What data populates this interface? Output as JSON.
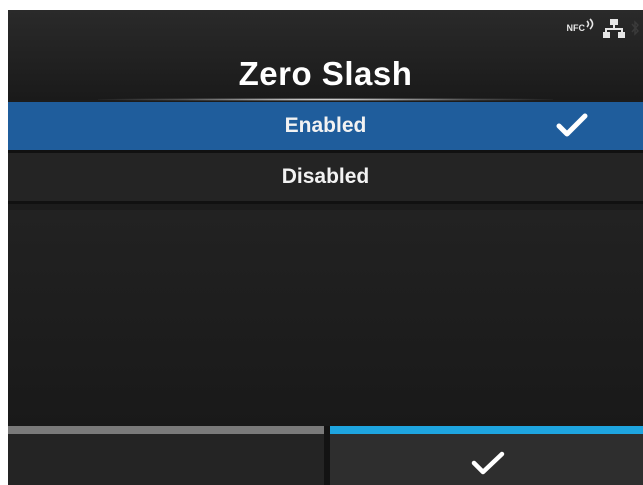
{
  "header": {
    "title": "Zero Slash",
    "status": {
      "nfc_label": "NFC"
    }
  },
  "options": [
    {
      "label": "Enabled",
      "selected": true
    },
    {
      "label": "Disabled",
      "selected": false
    }
  ],
  "footer": {
    "left_button": {
      "label": ""
    },
    "right_button": {
      "icon": "check-icon"
    }
  },
  "colors": {
    "selected_row": "#1f5d9c",
    "confirm_accent": "#1ea5e0",
    "left_accent": "#7a7a7a",
    "background": "#1c1c1c"
  }
}
